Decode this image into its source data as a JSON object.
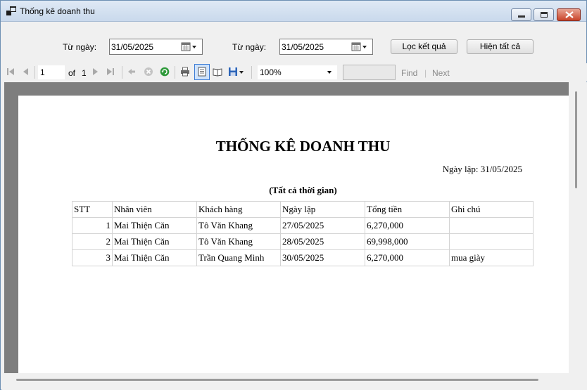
{
  "window": {
    "title": "Thống kê doanh thu"
  },
  "filter": {
    "from_label": "Từ ngày:",
    "from_value": "31/05/2025",
    "to_label": "Từ ngày:",
    "to_value": "31/05/2025",
    "filter_button": "Lọc kết quả",
    "show_all_button": "Hiện tất cả"
  },
  "toolbar": {
    "page_current": "1",
    "page_of_label": "of",
    "page_total": "1",
    "zoom": "100%",
    "find_label": "Find",
    "find_separator": "|",
    "next_label": "Next"
  },
  "report": {
    "title": "THỐNG KÊ DOANH THU",
    "date_line": "Ngày lập: 31/05/2025",
    "subtitle": "(Tất cả thời gian)",
    "headers": [
      "STT",
      "Nhân viên",
      "Khách hàng",
      "Ngày lập",
      "Tổng tiền",
      "Ghi chú"
    ],
    "rows": [
      [
        "1",
        "Mai Thiện Căn",
        "Tô Văn Khang",
        "27/05/2025",
        "6,270,000",
        ""
      ],
      [
        "2",
        "Mai Thiện Căn",
        "Tô Văn Khang",
        "28/05/2025",
        "69,998,000",
        ""
      ],
      [
        "3",
        "Mai Thiện Căn",
        "Trần Quang Minh",
        "30/05/2025",
        "6,270,000",
        "mua giày"
      ]
    ]
  },
  "icons": {
    "first_page": "first-page-icon",
    "prev_page": "previous-page-icon",
    "next_page": "next-page-icon",
    "last_page": "last-page-icon",
    "back": "back-icon",
    "stop": "stop-icon",
    "refresh": "refresh-icon",
    "print": "print-icon",
    "print_layout": "print-layout-icon",
    "page_setup": "page-setup-icon",
    "export": "export-icon",
    "calendar": "calendar-icon"
  },
  "colors": {
    "title_bar": "#c9d9ec",
    "close_button": "#c9442a",
    "viewer_background": "#7e7e7e",
    "refresh_icon": "#2e9a3a",
    "export_icon": "#2b64b8"
  }
}
